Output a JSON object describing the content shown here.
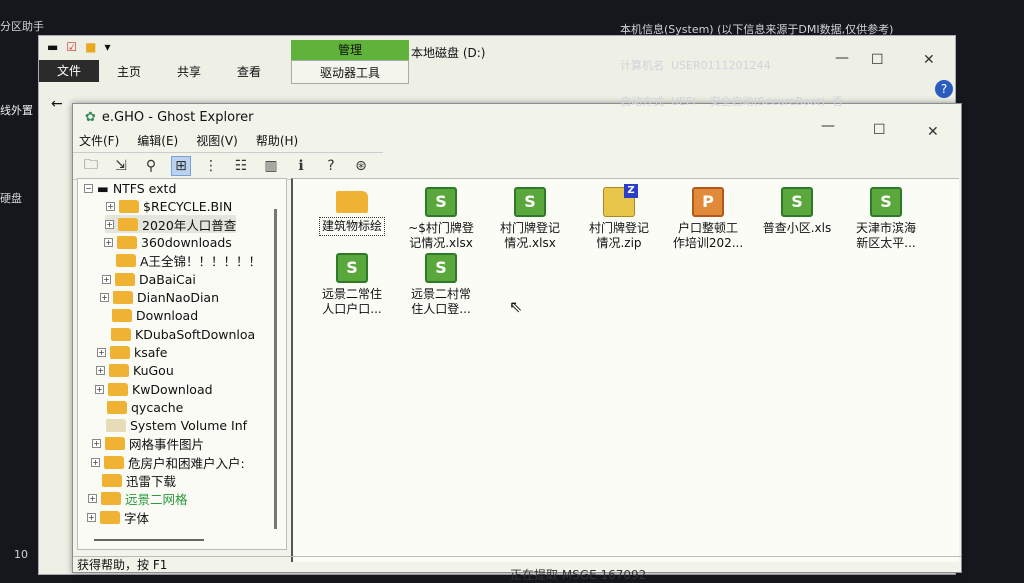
{
  "desktop": {
    "partition_tool": "分区助手",
    "left_labels": [
      "线外置",
      "硬盘",
      "10"
    ]
  },
  "sysinfo": [
    "本机信息(System) (以下信息来源于DMI数据,仅供参考)",
    "计算机名  USER0111201244",
    "启动方式  UEFI    安全启动(SecureBoot)  否"
  ],
  "back_window": {
    "title": "本地磁盘 (D:)",
    "manage_tab": "管理",
    "drive_tools_tab": "驱动器工具",
    "tabs": [
      "文件",
      "主页",
      "共享",
      "查看"
    ]
  },
  "ghost": {
    "title": "e.GHO - Ghost Explorer",
    "menu": [
      "文件(F)",
      "编辑(E)",
      "视图(V)",
      "帮助(H)"
    ],
    "toolbar": [
      "open-folder",
      "extract",
      "find",
      "large-icons",
      "small-icons",
      "list",
      "details",
      "info",
      "help",
      "about"
    ],
    "tree": {
      "root": "NTFS extd",
      "items": [
        {
          "label": "$RECYCLE.BIN",
          "expand": true,
          "pale": false
        },
        {
          "label": "2020年人口普查",
          "expand": true,
          "pale": false,
          "selected": true
        },
        {
          "label": "360downloads",
          "expand": true,
          "pale": false
        },
        {
          "label": "A王全锦！！！！！！",
          "expand": false,
          "pale": false
        },
        {
          "label": "DaBaiCai",
          "expand": true,
          "pale": false
        },
        {
          "label": "DianNaoDian",
          "expand": true,
          "pale": false
        },
        {
          "label": "Download",
          "expand": false,
          "pale": false
        },
        {
          "label": "KDubaSoftDownloa",
          "expand": false,
          "pale": false
        },
        {
          "label": "ksafe",
          "expand": true,
          "pale": false
        },
        {
          "label": "KuGou",
          "expand": true,
          "pale": false
        },
        {
          "label": "KwDownload",
          "expand": true,
          "pale": false
        },
        {
          "label": "qycache",
          "expand": false,
          "pale": false
        },
        {
          "label": "System Volume Inf",
          "expand": false,
          "pale": true
        },
        {
          "label": "网格事件图片",
          "expand": true,
          "pale": false
        },
        {
          "label": "危房户和困难户入户:",
          "expand": true,
          "pale": false
        },
        {
          "label": "迅雷下载",
          "expand": false,
          "pale": false
        },
        {
          "label": "远景二网格",
          "expand": true,
          "pale": false,
          "accent": "#2a9a3a"
        },
        {
          "label": "字体",
          "expand": true,
          "pale": false
        }
      ]
    },
    "files": [
      {
        "name": "建筑物标绘",
        "type": "folder"
      },
      {
        "name": "~$村门牌登记情况.xlsx",
        "line1": "~$村门牌登",
        "line2": "记情况.xlsx",
        "type": "xls"
      },
      {
        "name": "村门牌登记情况.xlsx",
        "line1": "村门牌登记",
        "line2": "情况.xlsx",
        "type": "xls"
      },
      {
        "name": "村门牌登记情况.zip",
        "line1": "村门牌登记",
        "line2": "情况.zip",
        "type": "zip"
      },
      {
        "name": "户口整顿工作培训202...",
        "line1": "户口整顿工",
        "line2": "作培训202...",
        "type": "ppt"
      },
      {
        "name": "普查小区.xls",
        "line1": "普查小区.xls",
        "line2": "",
        "type": "xls"
      },
      {
        "name": "天津市滨海新区太平...",
        "line1": "天津市滨海",
        "line2": "新区太平...",
        "type": "xls"
      },
      {
        "name": "远景二常住人口户口...",
        "line1": "远景二常住",
        "line2": "人口户口...",
        "type": "xls"
      },
      {
        "name": "远景二村常住人口登...",
        "line1": "远景二村常",
        "line2": "住人口登...",
        "type": "xls"
      }
    ],
    "status": "获得帮助，按 F1",
    "bottom_text": "正在提取 MSGE 167092"
  }
}
